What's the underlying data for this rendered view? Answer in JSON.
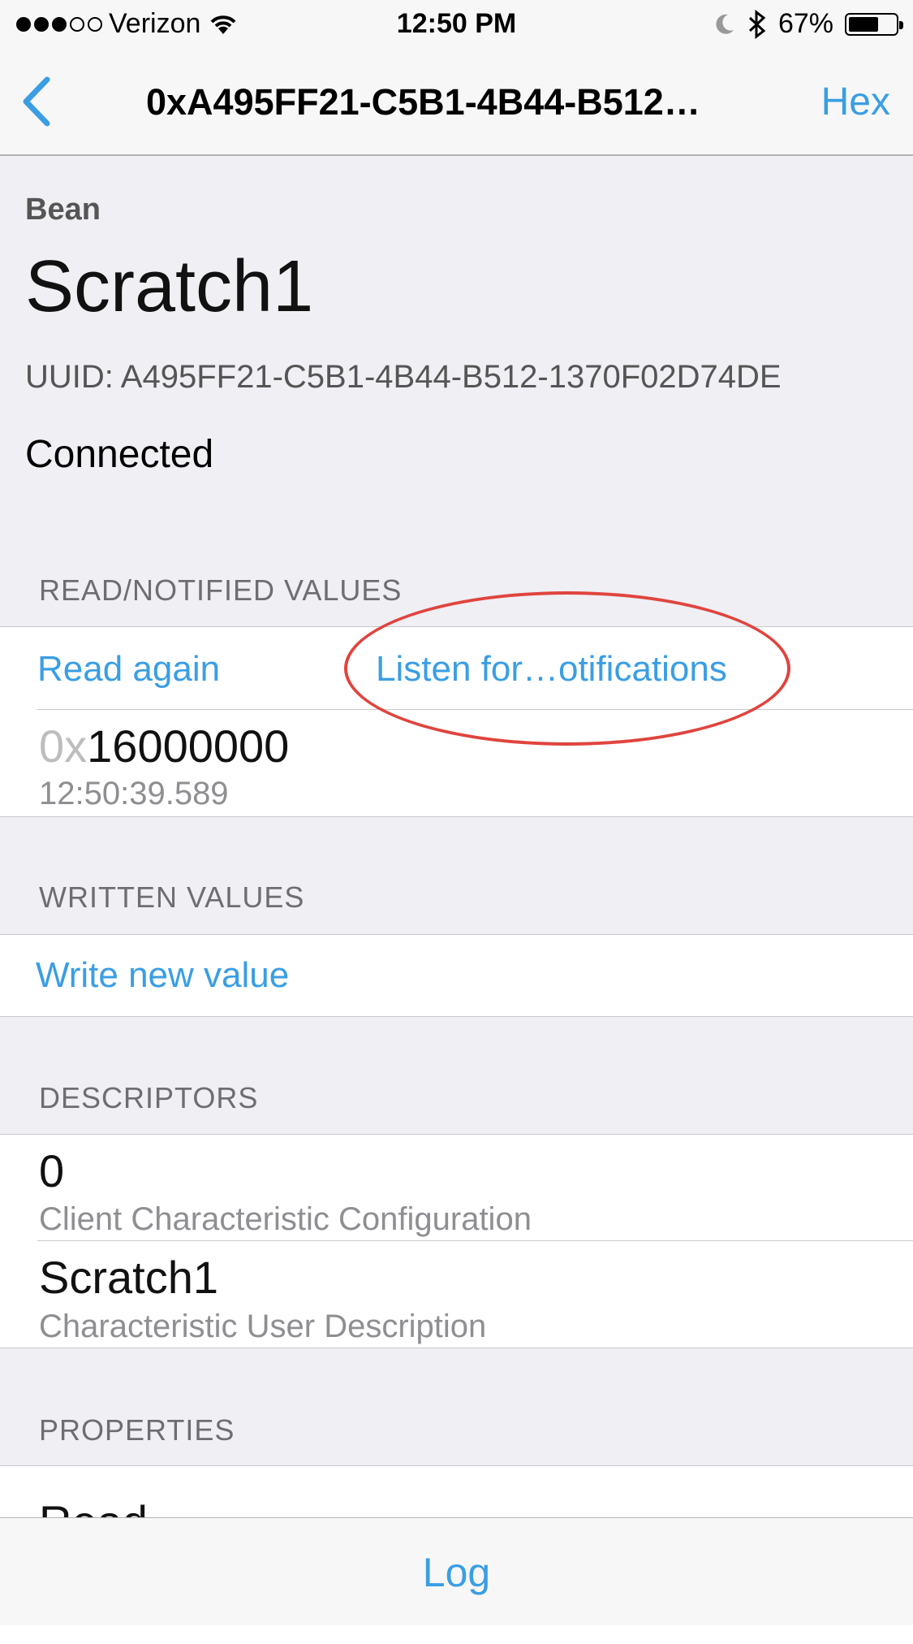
{
  "status_bar": {
    "carrier": "Verizon",
    "time": "12:50 PM",
    "battery": "67%",
    "battery_level": 0.67,
    "signal_dots_filled": 3,
    "signal_dots_total": 5
  },
  "nav": {
    "title": "0xA495FF21-C5B1-4B44-B512…",
    "right_button": "Hex"
  },
  "header": {
    "subtitle": "Bean",
    "title": "Scratch1",
    "uuid": "UUID: A495FF21-C5B1-4B44-B512-1370F02D74DE",
    "status": "Connected"
  },
  "read_section": {
    "header": "READ/NOTIFIED VALUES",
    "read_again": "Read again",
    "listen": "Listen for…otifications",
    "value_prefix": "0x",
    "value": "16000000",
    "timestamp": "12:50:39.589"
  },
  "written_section": {
    "header": "WRITTEN VALUES",
    "write_new": "Write new value"
  },
  "descriptors_section": {
    "header": "DESCRIPTORS",
    "items": [
      {
        "value": "0",
        "label": "Client Characteristic Configuration"
      },
      {
        "value": "Scratch1",
        "label": "Characteristic User Description"
      }
    ]
  },
  "properties_section": {
    "header": "PROPERTIES",
    "first_item": "Read"
  },
  "toolbar": {
    "log": "Log"
  },
  "colors": {
    "accent": "#3a9ee4",
    "highlight": "#e0443e",
    "background": "#efeff4"
  }
}
